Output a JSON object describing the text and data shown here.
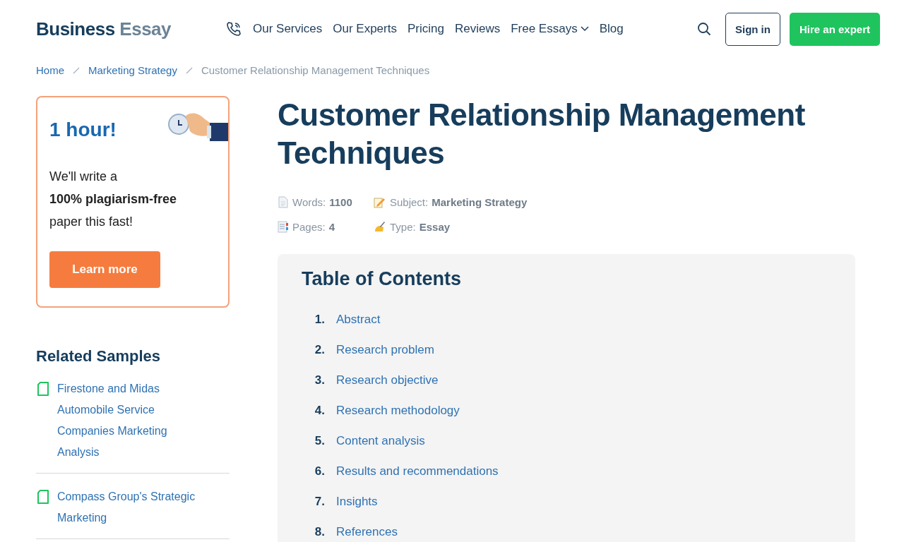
{
  "header": {
    "logo": {
      "first": "Business",
      "second": "Essay"
    },
    "nav": [
      {
        "label": "Our Services",
        "dropdown": false
      },
      {
        "label": "Our Experts",
        "dropdown": false
      },
      {
        "label": "Pricing",
        "dropdown": false
      },
      {
        "label": "Reviews",
        "dropdown": false
      },
      {
        "label": "Free Essays",
        "dropdown": true
      },
      {
        "label": "Blog",
        "dropdown": false
      }
    ],
    "sign_in": "Sign in",
    "hire": "Hire an expert"
  },
  "breadcrumbs": [
    {
      "label": "Home",
      "current": false
    },
    {
      "label": "Marketing Strategy",
      "current": false
    },
    {
      "label": "Customer Relationship Management Techniques",
      "current": true
    }
  ],
  "promo": {
    "title": "1 hour!",
    "text": "We'll write a **100% plagiarism-free** paper this fast!",
    "button": "Learn more"
  },
  "related": {
    "title": "Related Samples",
    "items": [
      "Firestone and Midas Automobile Service Companies Marketing Analysis",
      "Compass Group's Strategic Marketing"
    ]
  },
  "article": {
    "title": "Customer Relationship Management Techniques",
    "meta": [
      {
        "kind": "words",
        "label": "Words:",
        "value": "1100"
      },
      {
        "kind": "subject",
        "label": "Subject:",
        "value": "Marketing Strategy"
      },
      {
        "kind": "pages",
        "label": "Pages:",
        "value": "4"
      },
      {
        "kind": "type",
        "label": "Type:",
        "value": "Essay"
      }
    ],
    "toc": {
      "title": "Table of Contents",
      "items": [
        {
          "number": "1.",
          "label": "Abstract"
        },
        {
          "number": "2.",
          "label": "Research problem"
        },
        {
          "number": "3.",
          "label": "Research objective"
        },
        {
          "number": "4.",
          "label": "Research methodology"
        },
        {
          "number": "5.",
          "label": "Content analysis"
        },
        {
          "number": "6.",
          "label": "Results and recommendations"
        },
        {
          "number": "7.",
          "label": "Insights"
        },
        {
          "number": "8.",
          "label": "References"
        }
      ]
    }
  }
}
